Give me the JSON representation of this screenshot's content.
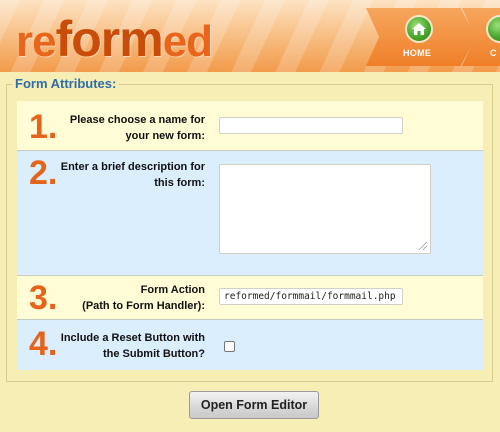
{
  "app": {
    "logo_re": "re",
    "logo_form": "form",
    "logo_ed": "ed"
  },
  "nav": {
    "home_label": "HOME",
    "next_label": "C"
  },
  "form": {
    "legend": "Form Attributes:",
    "rows": [
      {
        "num": "1.",
        "label_line1": "Please choose a name for",
        "label_line2": "your new form:",
        "value": ""
      },
      {
        "num": "2.",
        "label_line1": "Enter a brief description for",
        "label_line2": "this form:",
        "value": ""
      },
      {
        "num": "3.",
        "label_line1": "Form Action",
        "label_line2": "(Path to Form Handler):",
        "value": "reformed/formmail/formmail.php"
      },
      {
        "num": "4.",
        "label_line1": "Include a Reset Button with",
        "label_line2": "the Submit Button?",
        "checked": false
      }
    ],
    "submit_label": "Open Form Editor"
  }
}
